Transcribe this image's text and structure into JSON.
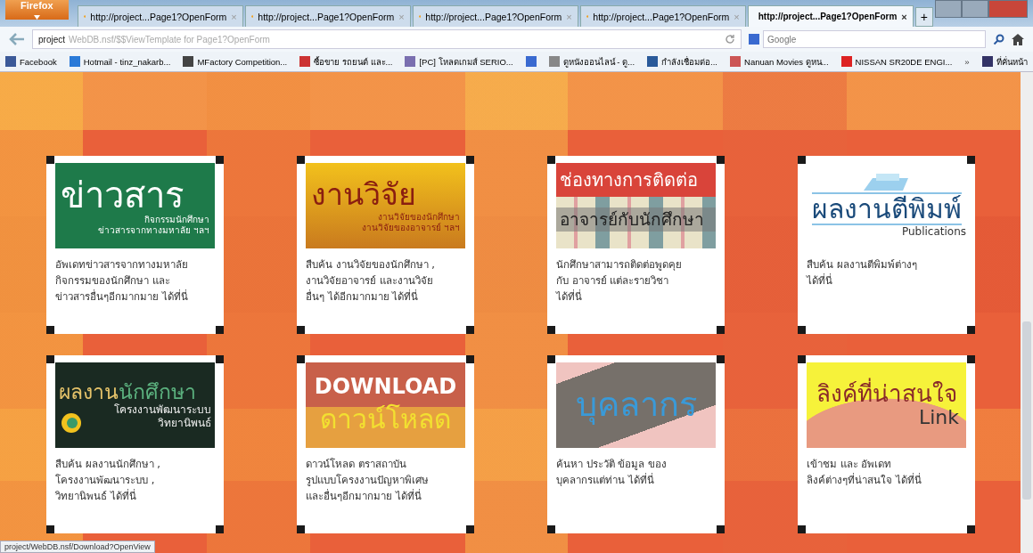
{
  "browser": {
    "menu_button": "Firefox",
    "tabs": [
      {
        "title": "http://project...Page1?OpenForm",
        "close": "×",
        "selected": false
      },
      {
        "title": "http://project...Page1?OpenForm",
        "close": "×",
        "selected": false
      },
      {
        "title": "http://project...Page1?OpenForm",
        "close": "×",
        "selected": false
      },
      {
        "title": "http://project...Page1?OpenForm",
        "close": "×",
        "selected": false
      },
      {
        "title": "http://project...Page1?OpenForm",
        "close": "×",
        "selected": true
      }
    ],
    "new_tab": "+",
    "address": {
      "host": "project",
      "path": "WebDB.nsf/$$ViewTemplate for Page1?OpenForm"
    },
    "search": {
      "placeholder": "Google"
    },
    "bookmarks": [
      {
        "kind": "link",
        "label": "Facebook"
      },
      {
        "kind": "link",
        "label": "Hotmail - tinz_nakarb..."
      },
      {
        "kind": "link",
        "label": "MFactory Competition..."
      },
      {
        "kind": "link",
        "label": "ซื้อขาย รถยนต์ และ..."
      },
      {
        "kind": "link",
        "label": "[PC] โหลดเกมส์ SERIO..."
      },
      {
        "kind": "icon"
      },
      {
        "kind": "link",
        "label": "ดูหนังออนไลน์ - ดู..."
      },
      {
        "kind": "link",
        "label": "กำลังเชื่อมต่อ..."
      },
      {
        "kind": "link",
        "label": "Nanuan Movies ดูหน..."
      },
      {
        "kind": "link",
        "label": "NISSAN SR20DE ENGI..."
      }
    ],
    "more_bookmarks": "»",
    "bookmarks_menu": "ที่คั่นหน้า"
  },
  "cards": [
    {
      "kind": "news",
      "title": "ข่าวสาร",
      "subtitle": [
        "กิจกรรมนักศึกษา",
        "ข่าวสารจากทางมหาลัย ฯลฯ"
      ],
      "description": [
        "อัพเดทข่าวสารจากทางมหาลัย",
        "กิจกรรมของนักศึกษา และ",
        "ข่าวสารอื่นๆอีกมากมาย ได้ที่นี่"
      ]
    },
    {
      "kind": "research",
      "title": "งานวิจัย",
      "subtitle": [
        "งานวิจัยของนักศึกษา",
        "งานวิจัยของอาจารย์ ฯลฯ"
      ],
      "description": [
        "สืบค้น งานวิจัยของนักศึกษา ,",
        "งานวิจัยอาจารย์ และงานวิจัย",
        "อื่นๆ ได้อีกมากมาย ได้ที่นี่"
      ]
    },
    {
      "kind": "contact",
      "title": "ช่องทางการติดต่อ",
      "subtitle": [
        "อาจารย์กับนักศึกษา"
      ],
      "description": [
        "นักศึกษาสามารถติดต่อพูดคุย",
        "กับ อาจารย์ แต่ละรายวิชา",
        "ได้ที่นี่"
      ]
    },
    {
      "kind": "publications",
      "title": "ผลงานตีพิมพ์",
      "subtitle": [
        "Publications"
      ],
      "description": [
        "สืบค้น ผลงานตีพิมพ์ต่างๆ",
        "ได้ที่นี่"
      ]
    },
    {
      "kind": "student",
      "title": "ผลงาน",
      "title_accent": "นักศึกษา",
      "subtitle": [
        "โครงงานพัฒนาระบบ",
        "วิทยานิพนธ์"
      ],
      "description": [
        "สืบค้น ผลงานนักศึกษา ,",
        "โครงงานพัฒนาระบบ ,",
        "วิทยานิพนธ์ ได้ที่นี่"
      ]
    },
    {
      "kind": "download",
      "title": "DOWNLOAD",
      "subtitle": [
        "ดาวน์โหลด"
      ],
      "description": [
        "ดาวน์โหลด ตราสถาบัน",
        "รูปแบบโครงงานปัญหาพิเศษ",
        "และอื่นๆอีกมากมาย ได้ที่นี่"
      ]
    },
    {
      "kind": "staff",
      "title": "บุคลากร",
      "description": [
        "ค้นหา ประวัติ ข้อมูล ของ",
        "บุคลากรแต่ท่าน ได้ที่นี่"
      ]
    },
    {
      "kind": "links",
      "title": "ลิงค์ที่น่าสนใจ",
      "subtitle": [
        "Link"
      ],
      "description": [
        "เข้าชม และ อัพเดท",
        "ลิงค์ต่างๆที่น่าสนใจ ได้ที่นี่"
      ]
    }
  ],
  "status_bar": "project/WebDB.nsf/Download?OpenView"
}
